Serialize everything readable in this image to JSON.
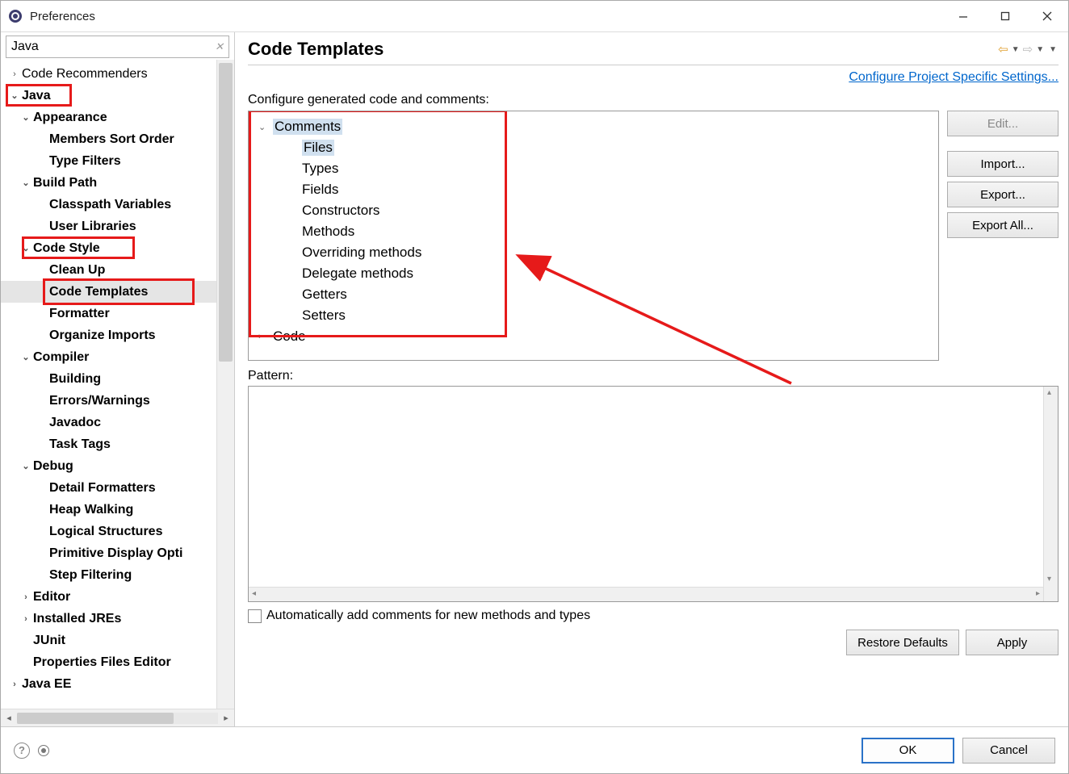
{
  "window": {
    "title": "Preferences"
  },
  "filter": {
    "value": "Java"
  },
  "sidebar": {
    "items": [
      {
        "label": "Code Recommenders",
        "depth": 0,
        "twisty": "closed",
        "bold": false
      },
      {
        "label": "Java",
        "depth": 0,
        "twisty": "open",
        "bold": true,
        "redbox": true
      },
      {
        "label": "Appearance",
        "depth": 1,
        "twisty": "open",
        "bold": true
      },
      {
        "label": "Members Sort Order",
        "depth": 2,
        "twisty": "",
        "bold": true
      },
      {
        "label": "Type Filters",
        "depth": 2,
        "twisty": "",
        "bold": true
      },
      {
        "label": "Build Path",
        "depth": 1,
        "twisty": "open",
        "bold": true
      },
      {
        "label": "Classpath Variables",
        "depth": 2,
        "twisty": "",
        "bold": true
      },
      {
        "label": "User Libraries",
        "depth": 2,
        "twisty": "",
        "bold": true
      },
      {
        "label": "Code Style",
        "depth": 1,
        "twisty": "open",
        "bold": true,
        "redbox": true
      },
      {
        "label": "Clean Up",
        "depth": 2,
        "twisty": "",
        "bold": true
      },
      {
        "label": "Code Templates",
        "depth": 2,
        "twisty": "",
        "bold": true,
        "selected": true,
        "redbox": true
      },
      {
        "label": "Formatter",
        "depth": 2,
        "twisty": "",
        "bold": true
      },
      {
        "label": "Organize Imports",
        "depth": 2,
        "twisty": "",
        "bold": true
      },
      {
        "label": "Compiler",
        "depth": 1,
        "twisty": "open",
        "bold": true
      },
      {
        "label": "Building",
        "depth": 2,
        "twisty": "",
        "bold": true
      },
      {
        "label": "Errors/Warnings",
        "depth": 2,
        "twisty": "",
        "bold": true
      },
      {
        "label": "Javadoc",
        "depth": 2,
        "twisty": "",
        "bold": true
      },
      {
        "label": "Task Tags",
        "depth": 2,
        "twisty": "",
        "bold": true
      },
      {
        "label": "Debug",
        "depth": 1,
        "twisty": "open",
        "bold": true
      },
      {
        "label": "Detail Formatters",
        "depth": 2,
        "twisty": "",
        "bold": true
      },
      {
        "label": "Heap Walking",
        "depth": 2,
        "twisty": "",
        "bold": true
      },
      {
        "label": "Logical Structures",
        "depth": 2,
        "twisty": "",
        "bold": true
      },
      {
        "label": "Primitive Display Opti",
        "depth": 2,
        "twisty": "",
        "bold": true
      },
      {
        "label": "Step Filtering",
        "depth": 2,
        "twisty": "",
        "bold": true
      },
      {
        "label": "Editor",
        "depth": 1,
        "twisty": "closed",
        "bold": true
      },
      {
        "label": "Installed JREs",
        "depth": 1,
        "twisty": "closed",
        "bold": true
      },
      {
        "label": "JUnit",
        "depth": 1,
        "twisty": "",
        "bold": true
      },
      {
        "label": "Properties Files Editor",
        "depth": 1,
        "twisty": "",
        "bold": true
      },
      {
        "label": "Java EE",
        "depth": 0,
        "twisty": "closed",
        "bold": true
      }
    ]
  },
  "page": {
    "title": "Code Templates",
    "link": "Configure Project Specific Settings...",
    "cfglabel": "Configure generated code and comments:",
    "tree": [
      {
        "label": "Comments",
        "d": 0,
        "tw": "open",
        "sel": true
      },
      {
        "label": "Files",
        "d": 1,
        "sel": true
      },
      {
        "label": "Types",
        "d": 1
      },
      {
        "label": "Fields",
        "d": 1
      },
      {
        "label": "Constructors",
        "d": 1
      },
      {
        "label": "Methods",
        "d": 1
      },
      {
        "label": "Overriding methods",
        "d": 1
      },
      {
        "label": "Delegate methods",
        "d": 1
      },
      {
        "label": "Getters",
        "d": 1
      },
      {
        "label": "Setters",
        "d": 1
      },
      {
        "label": "Code",
        "d": 0,
        "tw": "closed"
      }
    ],
    "buttons": {
      "edit": "Edit...",
      "import": "Import...",
      "export": "Export...",
      "exportall": "Export All..."
    },
    "patternlabel": "Pattern:",
    "checkbox": "Automatically add comments for new methods and types",
    "restore": "Restore Defaults",
    "apply": "Apply"
  },
  "footer": {
    "ok": "OK",
    "cancel": "Cancel"
  }
}
